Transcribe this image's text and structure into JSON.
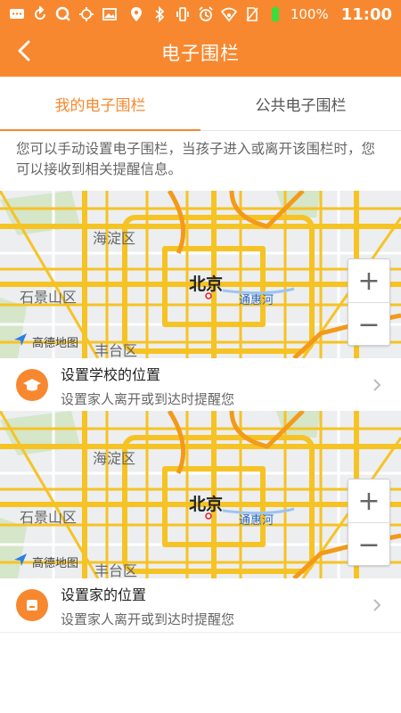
{
  "status_bar": {
    "battery": "100%",
    "time": "11:00",
    "icons_left": [
      "message-icon",
      "sync-icon",
      "search-q-icon",
      "crosshair-icon",
      "image-icon"
    ],
    "icons_right": [
      "location-icon",
      "bluetooth-icon",
      "vibrate-icon",
      "alarm-icon",
      "wifi-icon",
      "no-sim-icon",
      "battery-icon"
    ]
  },
  "header": {
    "title": "电子围栏"
  },
  "tabs": [
    {
      "label": "我的电子围栏",
      "active": true
    },
    {
      "label": "公共电子围栏",
      "active": false
    }
  ],
  "description": "您可以手动设置电子围栏，当孩子进入或离开该围栏时，您可以接收到相关提醒信息。",
  "maps": [
    {
      "labels": {
        "district1": "海淀区",
        "district2": "石景山区",
        "district3": "丰台区",
        "city": "北京",
        "river": "通惠河"
      },
      "zoom_in": "+",
      "zoom_out": "−",
      "brand": "高德地图"
    },
    {
      "labels": {
        "district1": "海淀区",
        "district2": "石景山区",
        "district3": "丰台区",
        "city": "北京",
        "river": "通惠河"
      },
      "zoom_in": "+",
      "zoom_out": "−",
      "brand": "高德地图"
    }
  ],
  "locations": [
    {
      "title": "设置学校的位置",
      "subtitle": "设置家人离开或到达时提醒您",
      "icon": "graduation-cap-icon"
    },
    {
      "title": "设置家的位置",
      "subtitle": "设置家人离开或到达时提醒您",
      "icon": "home-icon"
    }
  ],
  "colors": {
    "accent": "#f7882f",
    "road": "#f6c324",
    "river": "#2d68c4"
  }
}
